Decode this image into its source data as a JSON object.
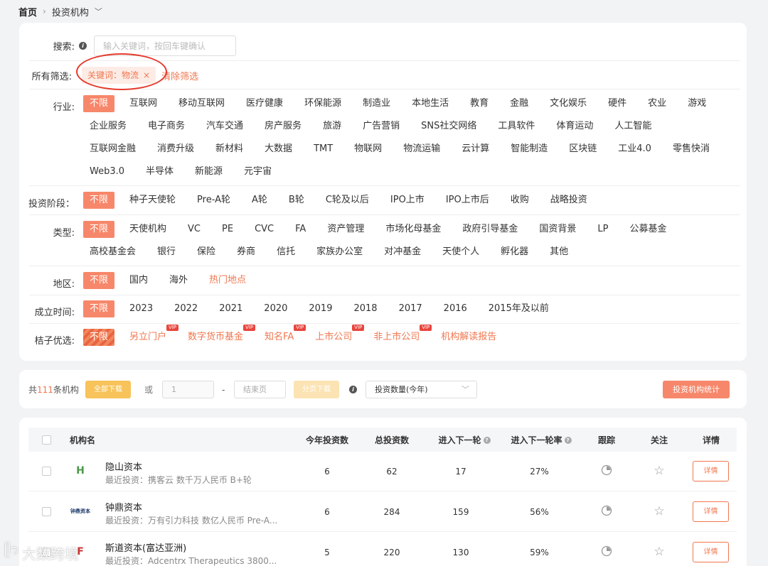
{
  "breadcrumb": {
    "home": "首页",
    "current": "投资机构"
  },
  "search": {
    "label": "搜索:",
    "placeholder": "输入关键词，按回车键确认"
  },
  "selected": {
    "label": "所有筛选:",
    "tag": "关键词：物流",
    "clear": "清除筛选"
  },
  "filters": {
    "industry": {
      "label": "行业:",
      "options": [
        "不限",
        "互联网",
        "移动互联网",
        "医疗健康",
        "环保能源",
        "制造业",
        "本地生活",
        "教育",
        "金融",
        "文化娱乐",
        "硬件",
        "农业",
        "游戏",
        "企业服务",
        "电子商务",
        "汽车交通",
        "房产服务",
        "旅游",
        "广告营销",
        "SNS社交网络",
        "工具软件",
        "体育运动",
        "人工智能",
        "互联网金融",
        "消费升级",
        "新材料",
        "大数据",
        "TMT",
        "物联网",
        "物流运输",
        "云计算",
        "智能制造",
        "区块链",
        "工业4.0",
        "零售快消",
        "Web3.0",
        "半导体",
        "新能源",
        "元宇宙"
      ]
    },
    "stage": {
      "label": "投资阶段：",
      "options": [
        "不限",
        "种子天使轮",
        "Pre-A轮",
        "A轮",
        "B轮",
        "C轮及以后",
        "IPO上市",
        "IPO上市后",
        "收购",
        "战略投资"
      ]
    },
    "type": {
      "label": "类型:",
      "options": [
        "不限",
        "天使机构",
        "VC",
        "PE",
        "CVC",
        "FA",
        "资产管理",
        "市场化母基金",
        "政府引导基金",
        "国资背景",
        "LP",
        "公募基金",
        "高校基金会",
        "银行",
        "保险",
        "券商",
        "信托",
        "家族办公室",
        "对冲基金",
        "天使个人",
        "孵化器",
        "其他"
      ]
    },
    "region": {
      "label": "地区:",
      "options": [
        "不限",
        "国内",
        "海外",
        "热门地点"
      ]
    },
    "year": {
      "label": "成立时间:",
      "options": [
        "不限",
        "2023",
        "2022",
        "2021",
        "2020",
        "2019",
        "2018",
        "2017",
        "2016",
        "2015年及以前"
      ]
    },
    "premium": {
      "label": "桔子优选:",
      "options": [
        "不限",
        "另立门户",
        "数字货币基金",
        "知名FA",
        "上市公司",
        "非上市公司",
        "机构解读报告"
      ],
      "vip": "VIP"
    }
  },
  "toolbar": {
    "total_prefix": "共",
    "total_count": "111",
    "total_suffix": "条机构",
    "download_all": "全部下载",
    "or": "或",
    "page_start": "1",
    "dash": "-",
    "page_end_placeholder": "结束页",
    "page_download": "分页下载",
    "sort_value": "投资数量(今年)",
    "stats_button": "投资机构统计"
  },
  "table": {
    "headers": {
      "name": "机构名",
      "this_year": "今年投资数",
      "total": "总投资数",
      "next_round": "进入下一轮",
      "next_rate": "进入下一轮率",
      "track": "跟踪",
      "follow": "关注",
      "detail": "详情"
    },
    "rows": [
      {
        "name": "隐山资本",
        "recent": "最近投资：携客云 数千万人民币 B+轮",
        "this_year": "6",
        "total": "62",
        "next_round": "17",
        "rate": "27%",
        "detail": "详情",
        "logo_text": "H"
      },
      {
        "name": "钟鼎资本",
        "recent": "最近投资：万有引力科技 数亿人民币 Pre-A...",
        "this_year": "6",
        "total": "284",
        "next_round": "159",
        "rate": "56%",
        "detail": "详情",
        "logo_text": "钟鼎资本"
      },
      {
        "name": "斯道资本(富达亚洲)",
        "recent": "最近投资：Adcentrx Therapeutics 3800...",
        "this_year": "5",
        "total": "220",
        "next_round": "130",
        "rate": "59%",
        "detail": "详情",
        "logo_text": "F"
      }
    ]
  },
  "watermark": "大数跨境",
  "colors": {
    "accent": "#f7876a",
    "orange_text": "#f0774f",
    "yellow": "#f7c35a",
    "annotation": "#e53a2d"
  }
}
